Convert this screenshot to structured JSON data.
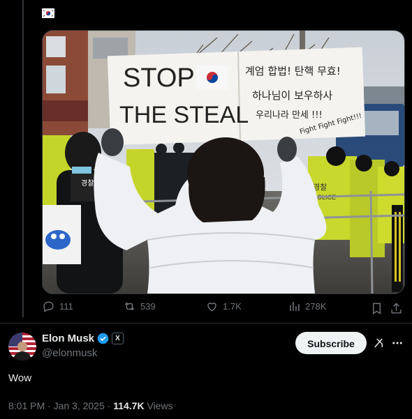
{
  "quoted_post": {
    "flag_icon": "south-korea-flag-icon",
    "media": {
      "sign_english_line1": "STOP",
      "sign_english_line2": "THE STEAL",
      "sign_korean_line1": "계엄 합법! 탄핵 무효!",
      "sign_korean_line2": "하나님이 보우하사",
      "sign_korean_line3": "우리나라 만세 !!!",
      "sign_fight": "Fight Fight Fight!!!",
      "vest_text": "경찰",
      "vest_police": "POLICE",
      "vest_text_left": "경찰대"
    },
    "actions": {
      "replies": "111",
      "reposts": "539",
      "likes": "1.7K",
      "views": "278K"
    }
  },
  "author": {
    "name": "Elon Musk",
    "handle": "@elonmusk",
    "verified_color": "#1d9bf0",
    "affiliation_badge": "X",
    "subscribe_label": "Subscribe"
  },
  "post": {
    "text": "Wow",
    "timestamp": "8:01 PM · Jan 3, 2025 · ",
    "views_count": "114.7K",
    "views_label": " Views"
  }
}
